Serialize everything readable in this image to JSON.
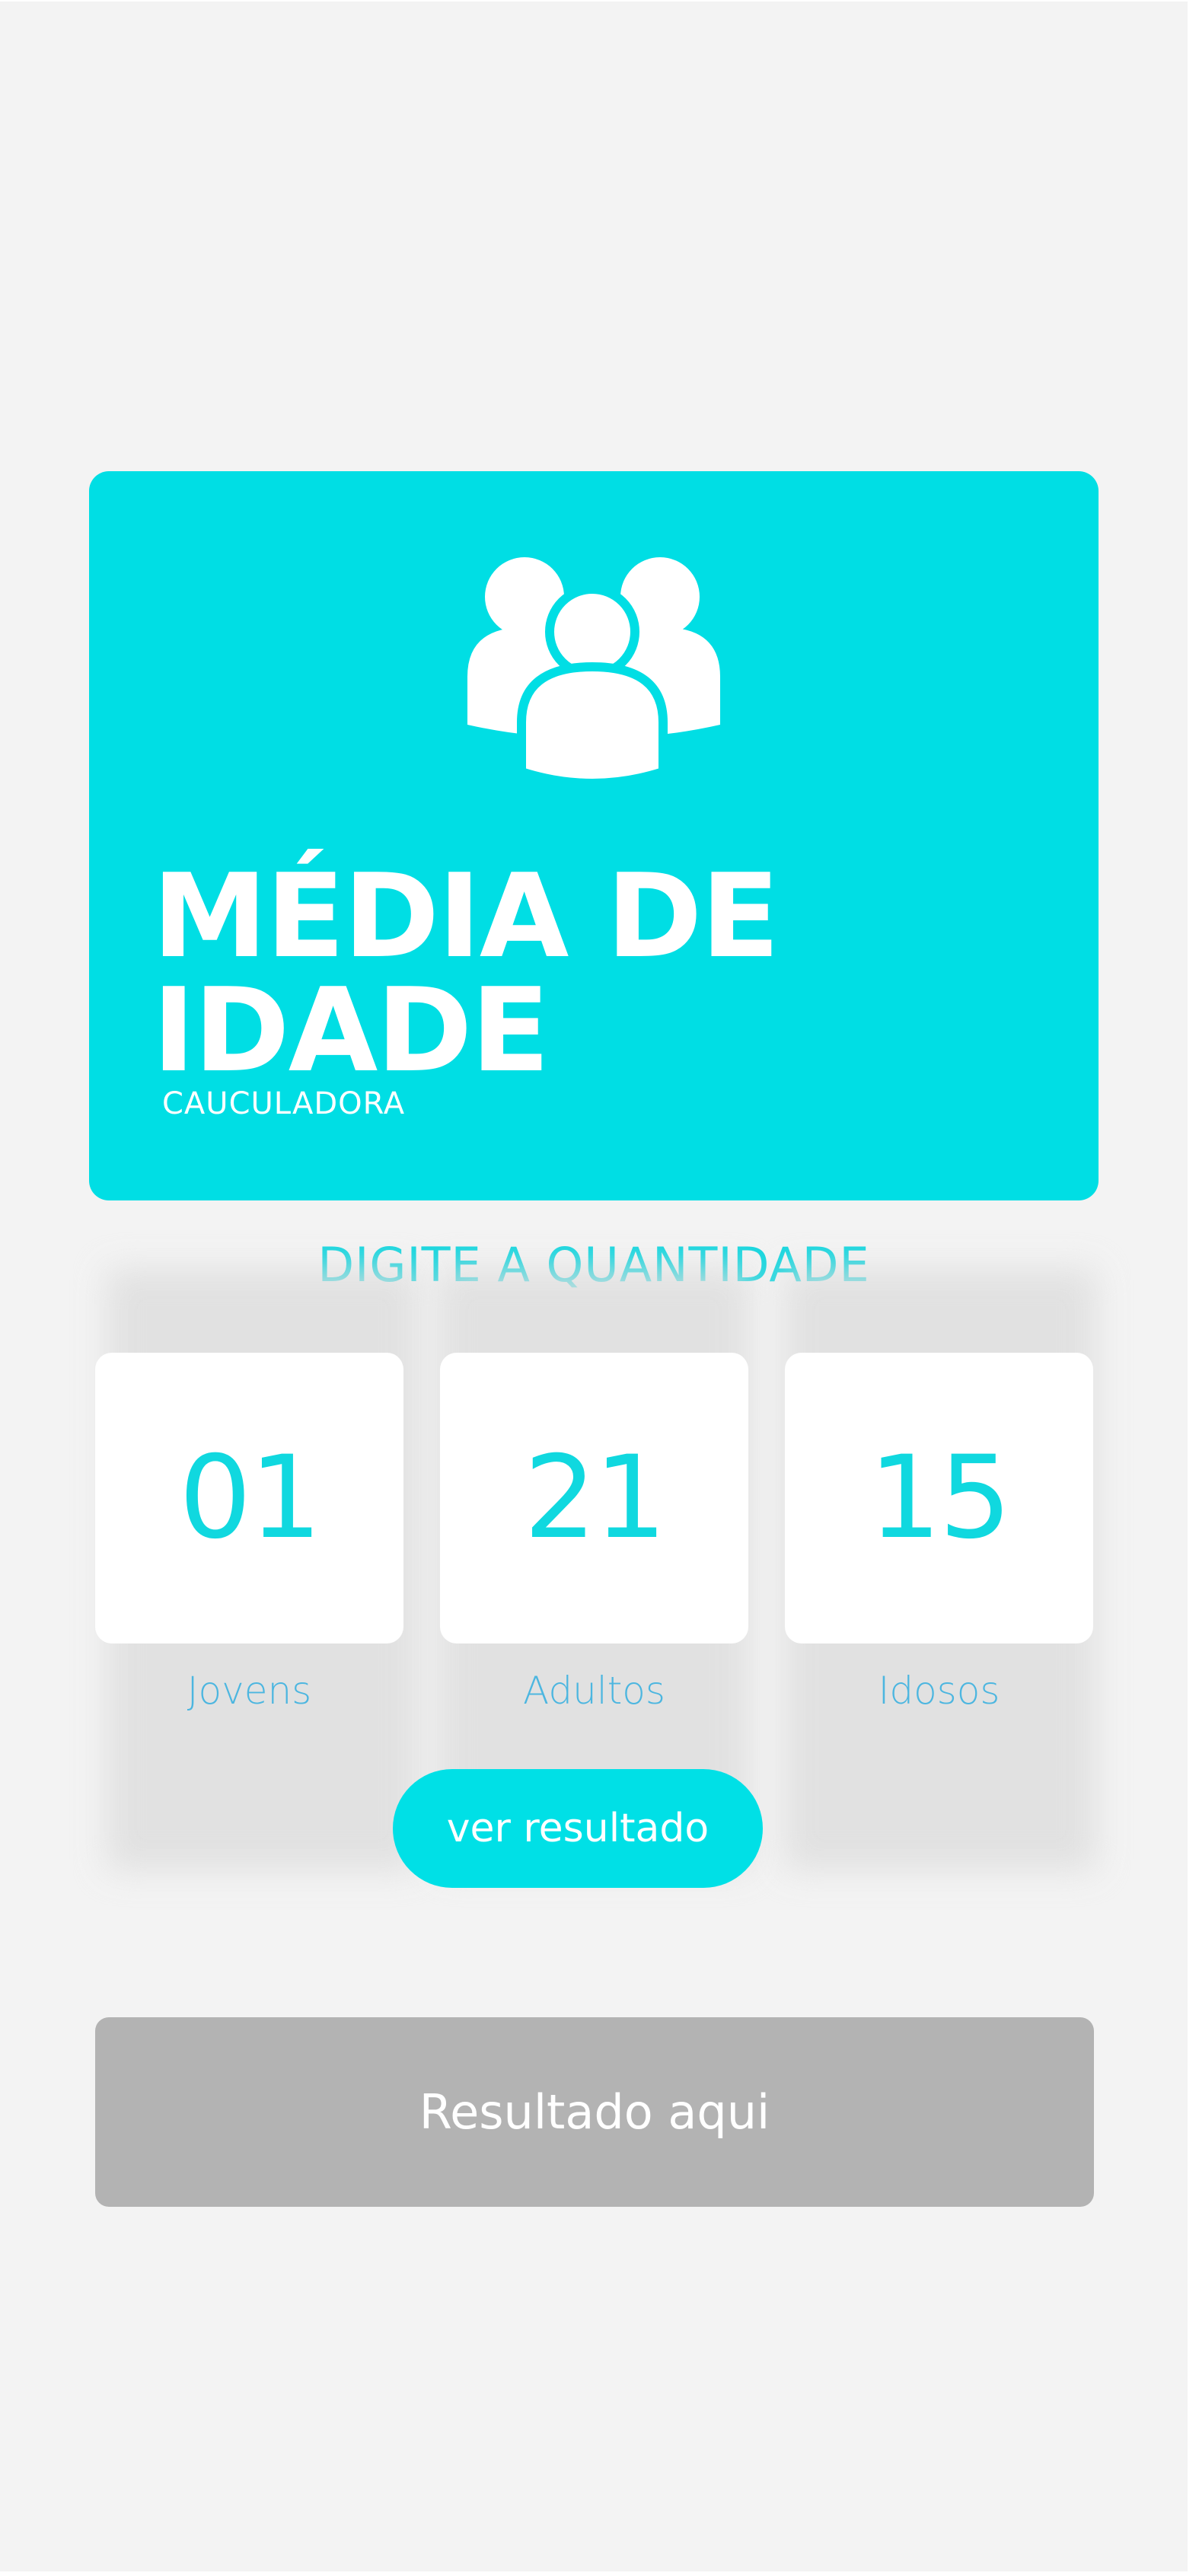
{
  "hero": {
    "icon": "people-group-icon",
    "title_line1": "MÉDIA DE",
    "title_line2": "IDADE",
    "subtitle": "CAUCULADORA",
    "background_color": "#00dee4"
  },
  "prompt": "DIGITE A QUANTIDADE",
  "counters": [
    {
      "value": "01",
      "label": "Jovens"
    },
    {
      "value": "21",
      "label": "Adultos"
    },
    {
      "value": "15",
      "label": "Idosos"
    }
  ],
  "result_button_label": "ver resultado",
  "result_text": "Resultado aqui",
  "colors": {
    "accent": "#00e0e6",
    "label": "#4cb6e0",
    "result_box": "#b3b3b3",
    "page_background": "#f3f3f3"
  }
}
